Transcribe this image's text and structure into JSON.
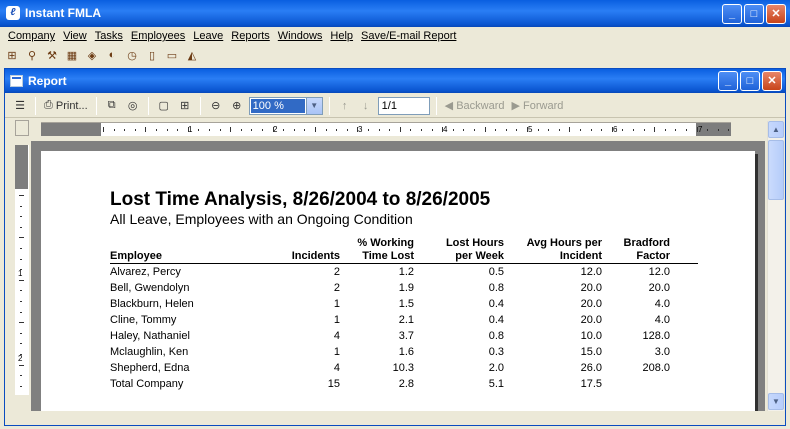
{
  "app": {
    "title": "Instant FMLA",
    "logo_glyph": "ℓ",
    "buttons": {
      "minimize": "_",
      "maximize": "□",
      "close": "✕"
    }
  },
  "menubar": [
    "Company",
    "View",
    "Tasks",
    "Employees",
    "Leave",
    "Reports",
    "Windows",
    "Help",
    "Save/E-mail Report"
  ],
  "app_toolbar": [
    {
      "name": "org-chart-icon",
      "glyph": "⊞"
    },
    {
      "name": "user-search-icon",
      "glyph": "⚲"
    },
    {
      "name": "tools-icon",
      "glyph": "⚒"
    },
    {
      "name": "calculator-icon",
      "glyph": "▦"
    },
    {
      "name": "leave-card-icon",
      "glyph": "◈"
    },
    {
      "name": "pill-icon",
      "glyph": "◐"
    },
    {
      "name": "clock-icon",
      "glyph": "◷"
    },
    {
      "name": "new-document-icon",
      "glyph": "▯"
    },
    {
      "name": "open-folder-icon",
      "glyph": "▭"
    },
    {
      "name": "help-icon",
      "glyph": "◭"
    }
  ],
  "report_window": {
    "title": "Report",
    "toolbar": {
      "toc_glyph": "☰",
      "print_glyph": "⎙",
      "print_label": "Print...",
      "copy_glyph": "⧉",
      "find_glyph": "◎",
      "single_page_glyph": "▢",
      "multi_page_glyph": "⊞",
      "zoom_out_glyph": "⊖",
      "zoom_in_glyph": "⊕",
      "zoom_value": "100 %",
      "zoom_arrow": "▼",
      "prev_page_glyph": "↑",
      "next_page_glyph": "↓",
      "page_value": "1/1",
      "back_glyph": "◀",
      "backward_label": "Backward",
      "forward_glyph": "▶",
      "forward_label": "Forward"
    },
    "ruler_numbers": [
      "1",
      "2",
      "3",
      "4",
      "5",
      "6",
      "7"
    ],
    "vruler_numbers": [
      "1",
      "2"
    ]
  },
  "report": {
    "title": "Lost Time Analysis, 8/26/2004 to 8/26/2005",
    "subtitle": "All Leave, Employees with an Ongoing Condition",
    "headers": {
      "employee": "Employee",
      "incidents": "Incidents",
      "pct_line1": "% Working",
      "pct_line2": "Time Lost",
      "lost_line1": "Lost Hours",
      "lost_line2": "per Week",
      "avg_line1": "Avg Hours per",
      "avg_line2": "Incident",
      "brad_line1": "Bradford",
      "brad_line2": "Factor"
    },
    "rows": [
      [
        "Alvarez, Percy",
        "2",
        "1.2",
        "0.5",
        "12.0",
        "12.0"
      ],
      [
        "Bell, Gwendolyn",
        "2",
        "1.9",
        "0.8",
        "20.0",
        "20.0"
      ],
      [
        "Blackburn, Helen",
        "1",
        "1.5",
        "0.4",
        "20.0",
        "4.0"
      ],
      [
        "Cline, Tommy",
        "1",
        "2.1",
        "0.4",
        "20.0",
        "4.0"
      ],
      [
        "Haley, Nathaniel",
        "4",
        "3.7",
        "0.8",
        "10.0",
        "128.0"
      ],
      [
        "Mclaughlin, Ken",
        "1",
        "1.6",
        "0.3",
        "15.0",
        "3.0"
      ],
      [
        "Shepherd, Edna",
        "4",
        "10.3",
        "2.0",
        "26.0",
        "208.0"
      ],
      [
        "Total Company",
        "15",
        "2.8",
        "5.1",
        "17.5",
        ""
      ]
    ]
  },
  "scroll": {
    "up": "▲",
    "down": "▼"
  }
}
